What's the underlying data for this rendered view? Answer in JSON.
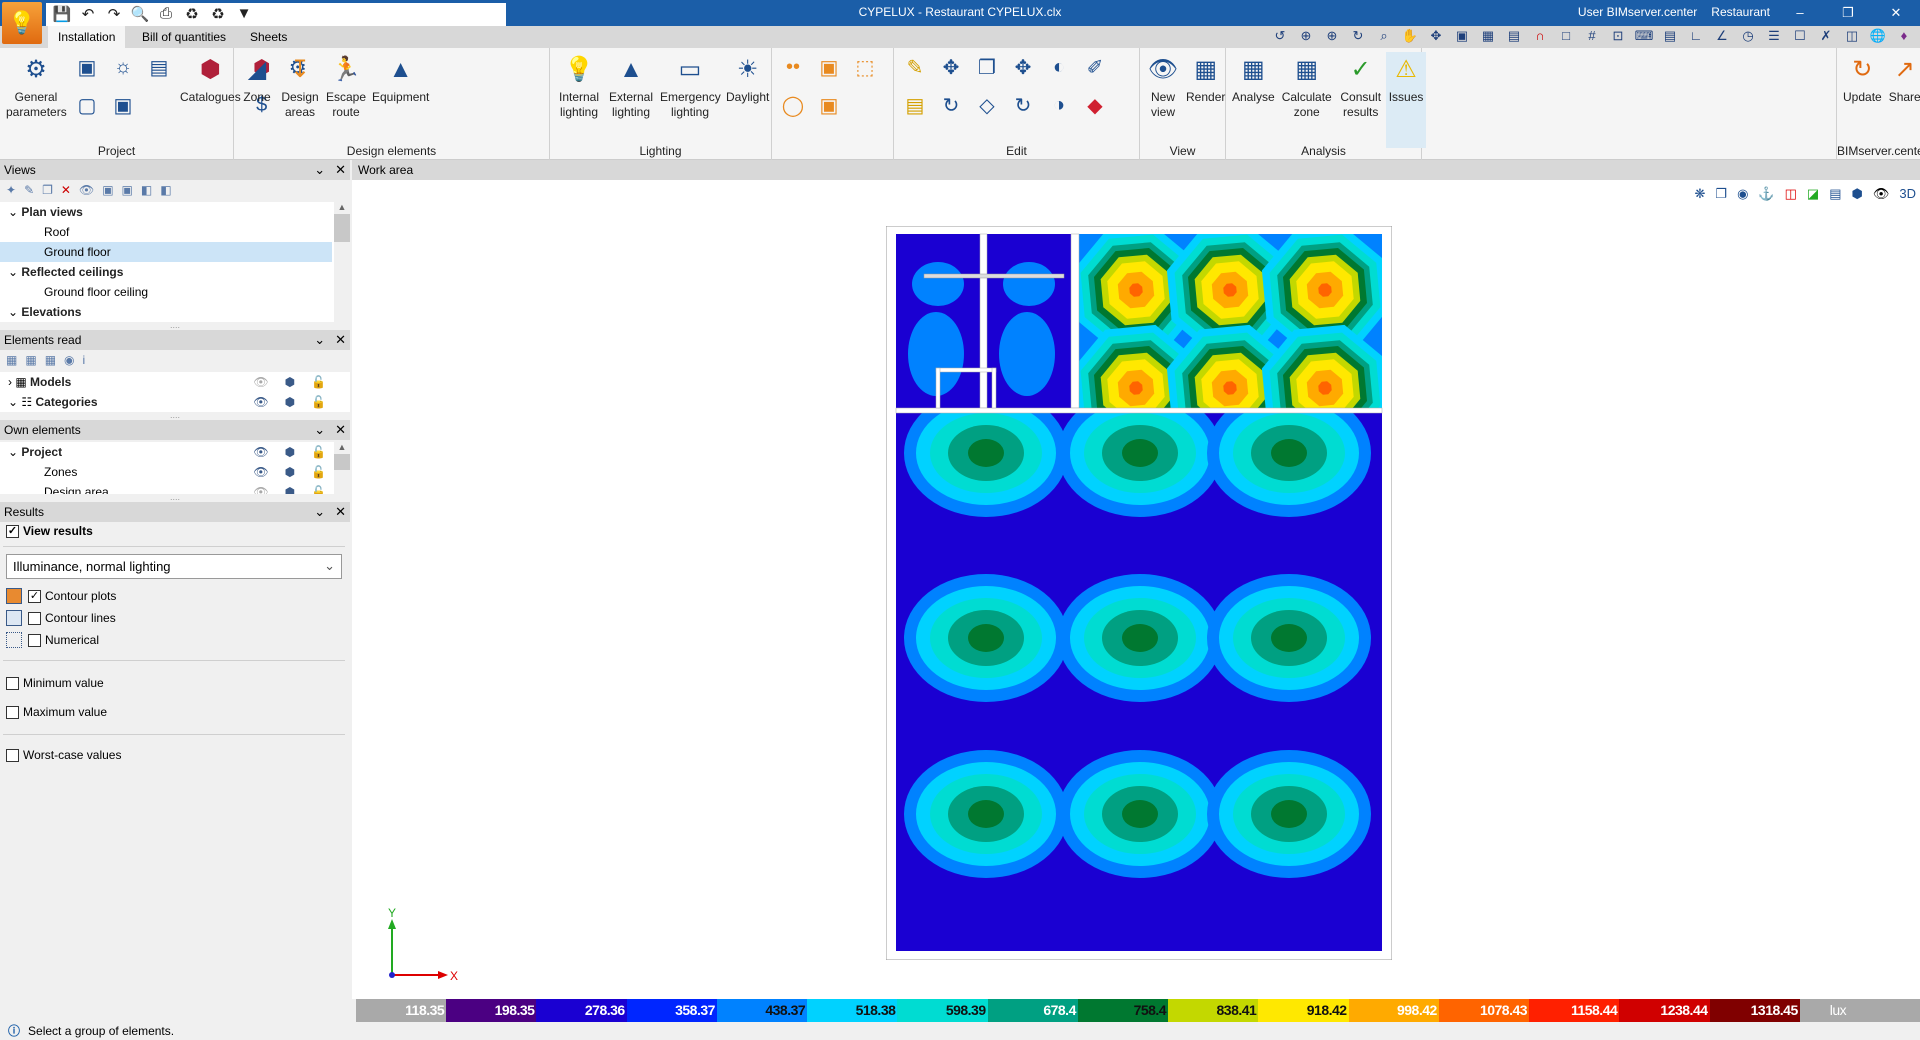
{
  "window": {
    "title": "CYPELUX - Restaurant CYPELUX.clx",
    "user": "User BIMserver.center",
    "project": "Restaurant"
  },
  "tabs": [
    "Installation",
    "Bill of quantities",
    "Sheets"
  ],
  "ribbon": {
    "project": {
      "label": "Project",
      "general": "General parameters",
      "catalogues": "Catalogues"
    },
    "design": {
      "label": "Design elements",
      "zone": "Zone",
      "design_areas": "Design areas",
      "escape": "Escape route",
      "equipment": "Equipment"
    },
    "lighting": {
      "label": "Lighting",
      "internal": "Internal lighting",
      "external": "External lighting",
      "emergency": "Emergency lighting",
      "daylight": "Daylight"
    },
    "edit": {
      "label": "Edit"
    },
    "view": {
      "label": "View",
      "new_view": "New view",
      "render": "Render"
    },
    "analysis": {
      "label": "Analysis",
      "analyse": "Analyse",
      "calculate": "Calculate zone",
      "consult": "Consult results",
      "issues": "Issues"
    },
    "bim": {
      "label": "BIMserver.center",
      "update": "Update",
      "share": "Share"
    }
  },
  "views": {
    "title": "Views",
    "items": [
      {
        "label": "Plan views",
        "group": true
      },
      {
        "label": "Roof"
      },
      {
        "label": "Ground floor",
        "selected": true
      },
      {
        "label": "Reflected ceilings",
        "group": true
      },
      {
        "label": "Ground floor ceiling"
      },
      {
        "label": "Elevations",
        "group": true
      }
    ]
  },
  "elements_read": {
    "title": "Elements read",
    "items": [
      "Models",
      "Categories"
    ]
  },
  "own_elements": {
    "title": "Own elements",
    "items": [
      "Project",
      "Zones",
      "Design area"
    ]
  },
  "results": {
    "title": "Results",
    "view_results": "View results",
    "select_value": "Illuminance, normal lighting",
    "contour_plots": "Contour plots",
    "contour_lines": "Contour lines",
    "numerical": "Numerical",
    "minimum": "Minimum value",
    "maximum": "Maximum value",
    "worst": "Worst-case values"
  },
  "work_area": {
    "title": "Work area",
    "axis_x": "X",
    "axis_y": "Y"
  },
  "legend": {
    "unit": "lux",
    "steps": [
      {
        "value": "118.35",
        "color": "#a9a9a9"
      },
      {
        "value": "198.35",
        "color": "#4b0082"
      },
      {
        "value": "278.36",
        "color": "#1a00d2"
      },
      {
        "value": "358.37",
        "color": "#0026ff"
      },
      {
        "value": "438.37",
        "color": "#0082ff"
      },
      {
        "value": "518.38",
        "color": "#00d2ff"
      },
      {
        "value": "598.39",
        "color": "#00dcd2"
      },
      {
        "value": "678.4",
        "color": "#00a082"
      },
      {
        "value": "758.4",
        "color": "#007830"
      },
      {
        "value": "838.41",
        "color": "#c3d800"
      },
      {
        "value": "918.42",
        "color": "#ffe800"
      },
      {
        "value": "998.42",
        "color": "#ffaa00"
      },
      {
        "value": "1078.43",
        "color": "#ff6400"
      },
      {
        "value": "1158.44",
        "color": "#ff2000"
      },
      {
        "value": "1238.44",
        "color": "#d00000"
      },
      {
        "value": "1318.45",
        "color": "#800000"
      }
    ]
  },
  "status": {
    "text": "Select a group of elements."
  }
}
